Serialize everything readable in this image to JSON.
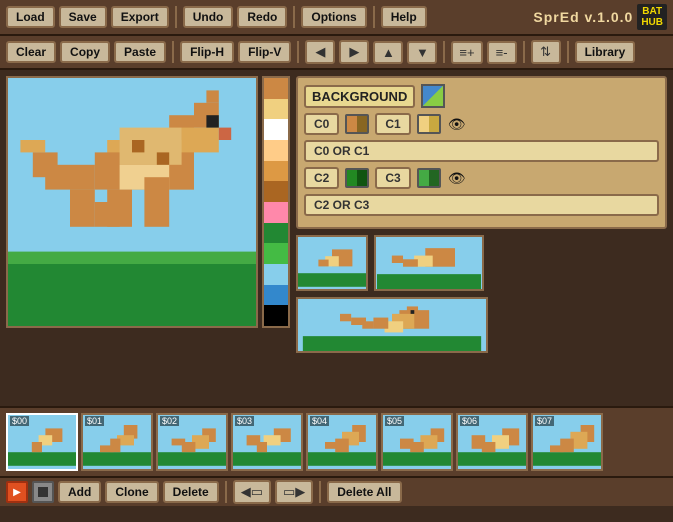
{
  "app": {
    "title": "SprEd v.1.0.0",
    "bat_hub": "BAT\nHUB"
  },
  "toolbar1": {
    "load": "Load",
    "save": "Save",
    "export": "Export",
    "undo": "Undo",
    "redo": "Redo",
    "options": "Options",
    "help": "Help"
  },
  "toolbar2": {
    "clear": "Clear",
    "copy": "Copy",
    "paste": "Paste",
    "flip_h": "Flip-H",
    "flip_v": "Flip-V",
    "library": "Library"
  },
  "panel": {
    "background_label": "BACKGROUND",
    "c0_label": "C0",
    "c1_label": "C1",
    "c0_or_c1": "C0 OR C1",
    "c2_label": "C2",
    "c3_label": "C3",
    "c2_or_c3": "C2 OR C3"
  },
  "frames": {
    "labels": [
      "$00",
      "$01",
      "$02",
      "$03",
      "$04",
      "$05",
      "$06",
      "$07"
    ]
  },
  "bottom_bar": {
    "add": "Add",
    "clone": "Clone",
    "delete": "Delete",
    "delete_all": "Delete All"
  },
  "palette_colors": [
    "#ff0000",
    "#ff8800",
    "#ffff00",
    "#00ff00",
    "#00ffff",
    "#0000ff",
    "#8800ff",
    "#ff00ff",
    "#ffffff",
    "#cccccc",
    "#888888",
    "#444444",
    "#000000",
    "#884400",
    "#cc8844",
    "#f0d080"
  ]
}
